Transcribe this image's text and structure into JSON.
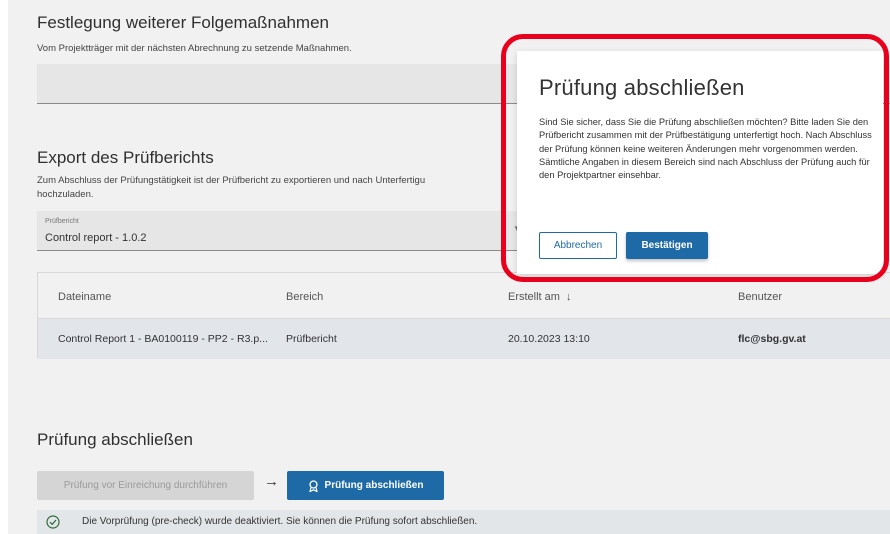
{
  "followup": {
    "title": "Festlegung weiterer Folgemaßnahmen",
    "subtitle": "Vom Projektträger mit der nächsten Abrechnung zu setzende Maßnahmen."
  },
  "export": {
    "title": "Export des Prüfberichts",
    "description_line1": "Zum Abschluss der Prüfungstätigkeit ist der Prüfbericht zu exportieren und nach Unterfertigu",
    "description_line2": "hochzuladen.",
    "select_label": "Prüfbericht",
    "select_value": "Control report - 1.0.2"
  },
  "table": {
    "headers": {
      "filename": "Dateiname",
      "area": "Bereich",
      "created": "Erstellt am",
      "user": "Benutzer"
    },
    "rows": [
      {
        "filename": "Control Report 1 - BA0100119 - PP2 - R3.p...",
        "area": "Prüfbericht",
        "created": "20.10.2023 13:10",
        "user": "flc@sbg.gv.at"
      }
    ]
  },
  "finish": {
    "title": "Prüfung abschließen",
    "precheck_button": "Prüfung vor Einreichung durchführen",
    "arrow": "→",
    "finish_button": "Prüfung abschließen",
    "info_text": "Die Vorprüfung (pre-check) wurde deaktiviert. Sie können die Prüfung sofort abschließen."
  },
  "modal": {
    "title": "Prüfung abschließen",
    "text": "Sind Sie sicher, dass Sie die Prüfung abschließen möchten? Bitte laden Sie den Prüfbericht zusammen mit der Prüfbestätigung unterfertigt hoch. Nach Abschluss der Prüfung können keine weiteren Änderungen mehr vorgenommen werden. Sämtliche Angaben in diesem Bereich sind nach Abschluss der Prüfung auch für den Projektpartner einsehbar.",
    "cancel": "Abbrechen",
    "confirm": "Bestätigen"
  },
  "colors": {
    "primary": "#1e6aa6",
    "highlight": "#e8001c",
    "page_bg": "#f1f1f1"
  },
  "icons": [
    "sort-down-icon",
    "dropdown-caret-icon",
    "award-icon",
    "check-circle-icon"
  ]
}
